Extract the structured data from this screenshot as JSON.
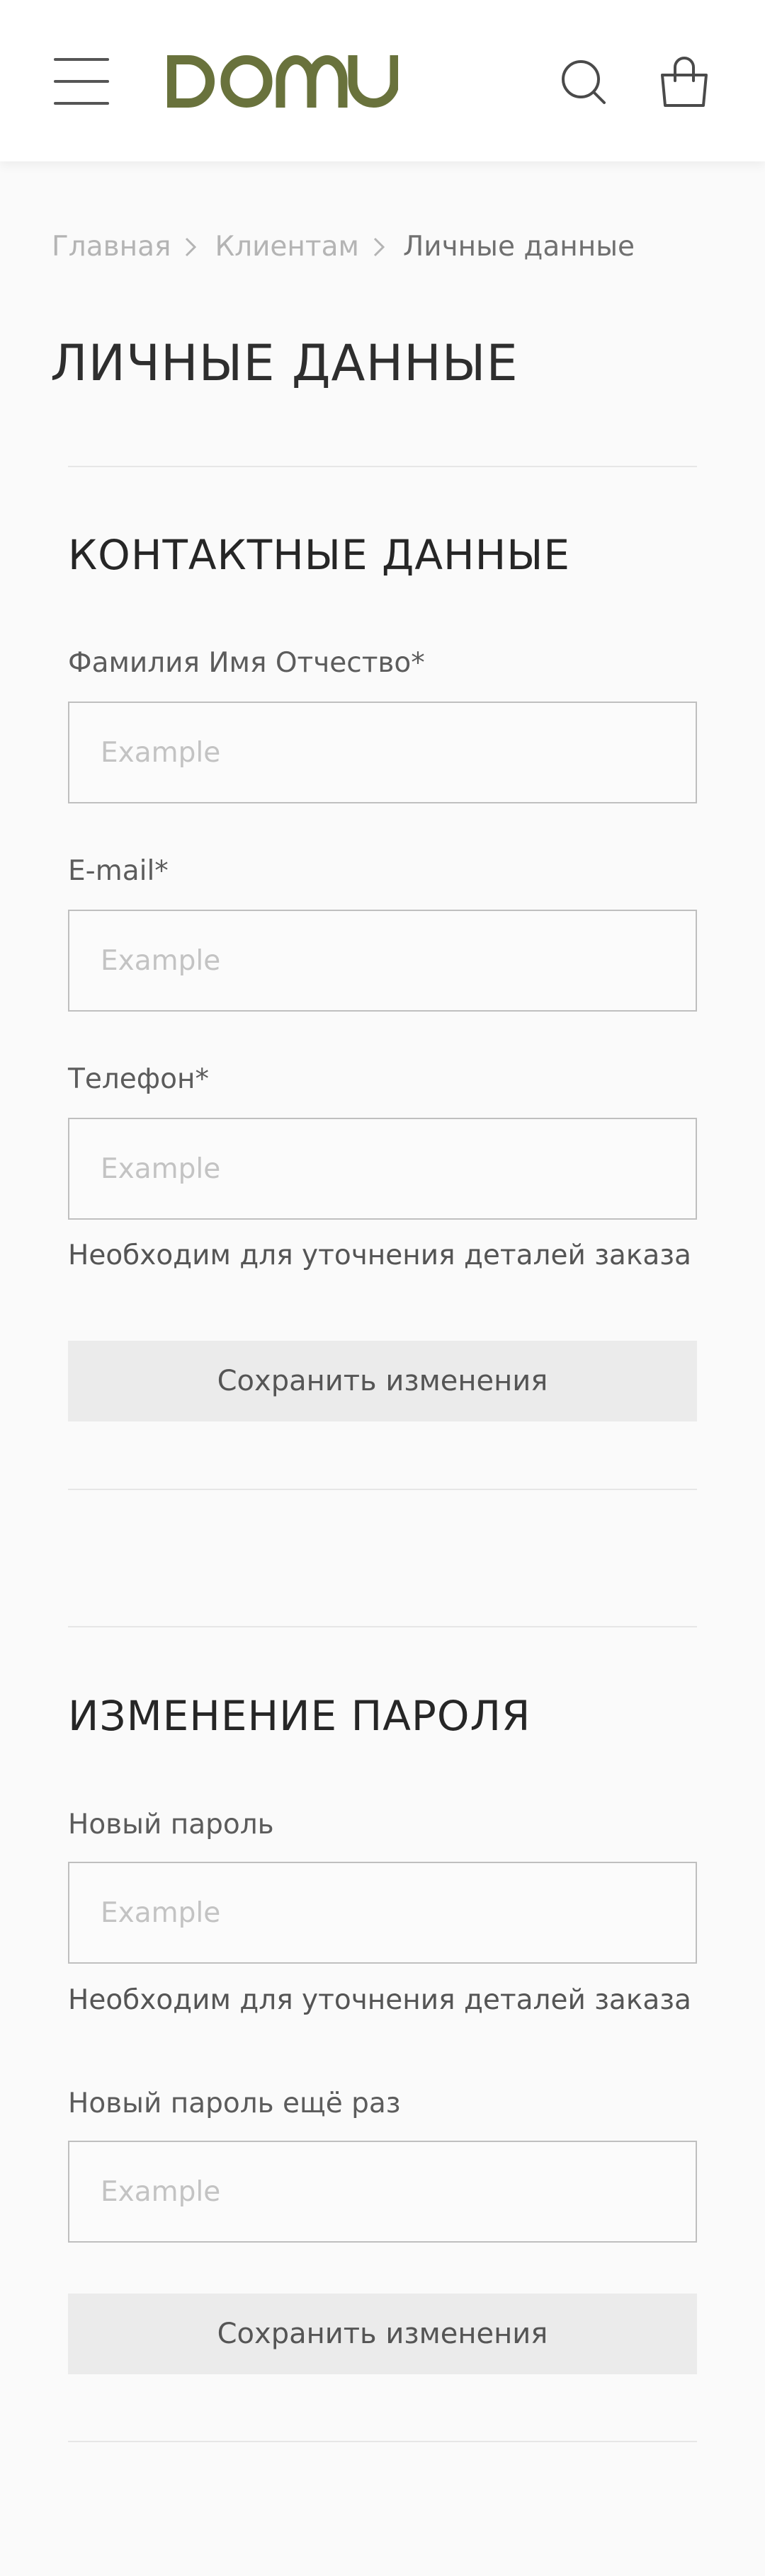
{
  "colors": {
    "brand": "#69723c",
    "background": "#fafafa",
    "button_bg": "#ebebeb",
    "border": "#bfbfbf"
  },
  "header": {
    "logo_text": "DOMU",
    "icons": [
      "menu-icon",
      "search-icon",
      "shopping-bag-icon"
    ]
  },
  "breadcrumb": {
    "items": [
      "Главная",
      "Клиентам"
    ],
    "current": "Личные данные"
  },
  "page_title": "ЛИЧНЫЕ ДАННЫЕ",
  "contacts": {
    "title": "КОНТАКТНЫЕ ДАННЫЕ",
    "name_label": "Фамилия Имя Отчество*",
    "name_placeholder": "Example",
    "email_label": "E-mail*",
    "email_placeholder": "Example",
    "phone_label": "Телефон*",
    "phone_placeholder": "Example",
    "phone_hint": "Необходим для уточнения деталей заказа",
    "save_label": "Сохранить изменения"
  },
  "password": {
    "title": "ИЗМЕНЕНИЕ ПАРОЛЯ",
    "new_label": "Новый пароль",
    "new_placeholder": "Example",
    "new_hint": "Необходим для уточнения деталей заказа",
    "repeat_label": "Новый пароль ещё раз",
    "repeat_placeholder": "Example",
    "save_label": "Сохранить изменения"
  }
}
